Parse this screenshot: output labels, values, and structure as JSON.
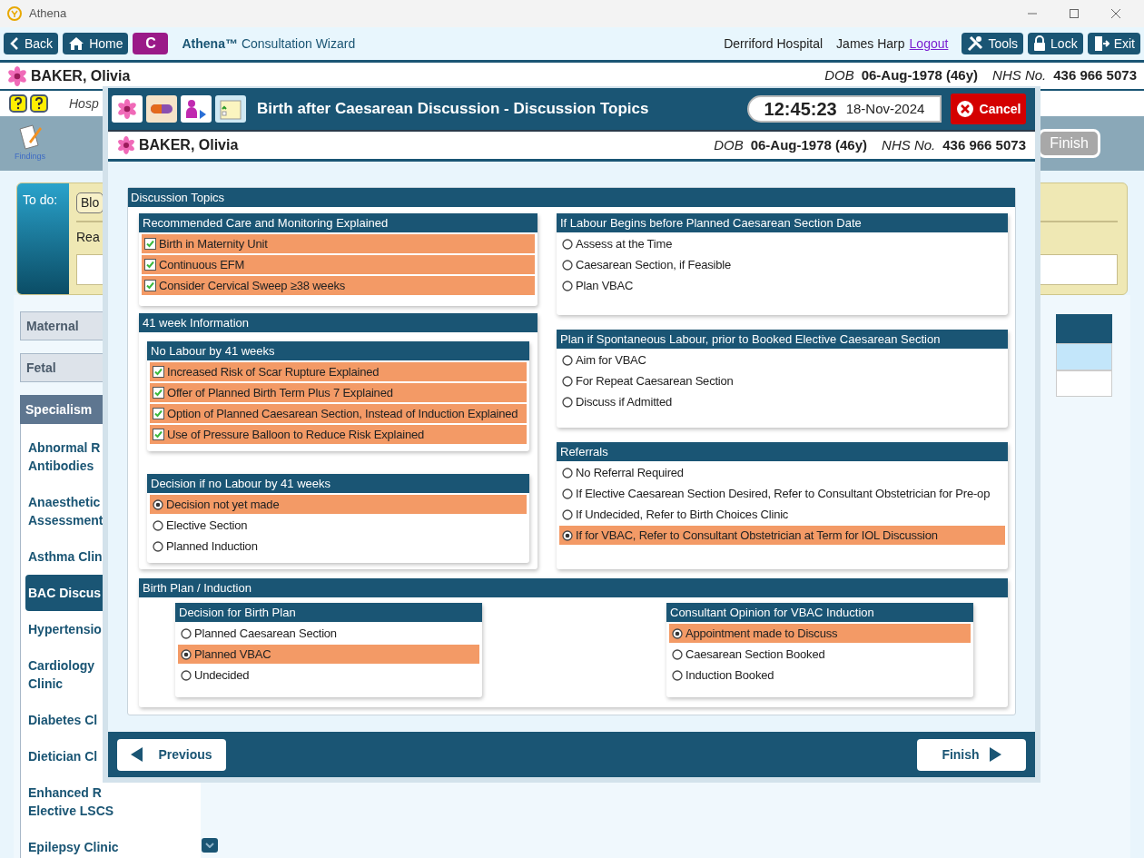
{
  "app_title": "Athena",
  "toolbar": {
    "left_buttons": [
      {
        "label": "Back"
      },
      {
        "label": "Home"
      }
    ],
    "badge": "C",
    "brand": "Athena™",
    "title": "Consultation Wizard",
    "hospital": "Derriford Hospital",
    "user": "James Harp",
    "logout": "Logout",
    "right_buttons": [
      {
        "label": "Tools"
      },
      {
        "label": "Lock"
      },
      {
        "label": "Exit"
      }
    ]
  },
  "patient": {
    "name": "BAKER, Olivia",
    "dob_label": "DOB",
    "dob": "06-Aug-1978 (46y)",
    "nhs_label": "NHS No.",
    "nhs": "436 966 5073"
  },
  "info_row": {
    "text": "Hosp"
  },
  "findings_label": "Findings",
  "finish_button": {
    "label": "Finish",
    "disabled": true
  },
  "todo": {
    "label": "To do:",
    "button": "Blo",
    "reason_label": "Rea"
  },
  "sidebar": {
    "headers": [
      {
        "label": "Maternal"
      },
      {
        "label": "Fetal"
      }
    ],
    "section": "Specialism",
    "items": [
      {
        "lines": [
          "Abnormal R",
          "Antibodies"
        ],
        "selected": false
      },
      {
        "lines": [
          "Anaesthetic",
          "Assessment"
        ],
        "selected": false
      },
      {
        "lines": [
          "Asthma Clin"
        ],
        "selected": false
      },
      {
        "lines": [
          "BAC Discus"
        ],
        "selected": true
      },
      {
        "lines": [
          "Hypertensio"
        ],
        "selected": false
      },
      {
        "lines": [
          "Cardiology",
          "Clinic"
        ],
        "selected": false
      },
      {
        "lines": [
          "Diabetes Cl"
        ],
        "selected": false
      },
      {
        "lines": [
          "Dietician Cl"
        ],
        "selected": false
      },
      {
        "lines": [
          "Enhanced R",
          "Elective LSCS"
        ],
        "selected": false
      },
      {
        "lines": [
          "Epilepsy Clinic"
        ],
        "selected": false
      }
    ]
  },
  "wizard": {
    "title": "Birth after Caesarean Discussion - Discussion Topics",
    "time": "12:45:23",
    "date": "18-Nov-2024",
    "cancel": "Cancel",
    "patient": {
      "name": "BAKER, Olivia",
      "dob_label": "DOB",
      "dob": "06-Aug-1978 (46y)",
      "nhs_label": "NHS No.",
      "nhs": "436 966 5073"
    },
    "panel_title": "Discussion Topics",
    "left_groups": [
      {
        "title": "Recommended Care and Monitoring Explained",
        "items": [
          {
            "kind": "checkbox",
            "label": "Birth in Maternity Unit",
            "checked": true
          },
          {
            "kind": "checkbox",
            "label": "Continuous EFM",
            "checked": true
          },
          {
            "kind": "checkbox",
            "label": "Consider Cervical Sweep ≥38 weeks",
            "checked": true
          }
        ]
      },
      {
        "title": "41 week Information",
        "subgroups": [
          {
            "title": "No Labour by 41 weeks",
            "items": [
              {
                "kind": "checkbox",
                "label": "Increased Risk of Scar Rupture Explained",
                "checked": true
              },
              {
                "kind": "checkbox",
                "label": "Offer of Planned Birth Term Plus 7 Explained",
                "checked": true
              },
              {
                "kind": "checkbox",
                "label": "Option of Planned Caesarean Section, Instead of Induction Explained",
                "checked": true
              },
              {
                "kind": "checkbox",
                "label": "Use of Pressure Balloon to Reduce Risk Explained",
                "checked": true
              }
            ]
          },
          {
            "title": "Decision if no Labour by 41 weeks",
            "items": [
              {
                "kind": "radio",
                "label": "Decision not yet made",
                "selected": true
              },
              {
                "kind": "radio",
                "label": "Elective Section",
                "selected": false
              },
              {
                "kind": "radio",
                "label": "Planned Induction",
                "selected": false
              }
            ]
          }
        ]
      }
    ],
    "right_groups": [
      {
        "title": "If Labour Begins before Planned Caesarean Section Date",
        "items": [
          {
            "kind": "radio",
            "label": "Assess at the Time",
            "selected": false
          },
          {
            "kind": "radio",
            "label": "Caesarean Section, if Feasible",
            "selected": false
          },
          {
            "kind": "radio",
            "label": "Plan VBAC",
            "selected": false
          }
        ]
      },
      {
        "title": "Plan if Spontaneous Labour, prior to Booked Elective Caesarean Section",
        "items": [
          {
            "kind": "radio",
            "label": "Aim for VBAC",
            "selected": false
          },
          {
            "kind": "radio",
            "label": "For Repeat Caesarean Section",
            "selected": false
          },
          {
            "kind": "radio",
            "label": "Discuss if Admitted",
            "selected": false
          }
        ]
      },
      {
        "title": "Referrals",
        "items": [
          {
            "kind": "radio",
            "label": "No Referral Required",
            "selected": false
          },
          {
            "kind": "radio",
            "label": "If Elective Caesarean Section Desired, Refer to Consultant Obstetrician for Pre-op",
            "selected": false
          },
          {
            "kind": "radio",
            "label": "If Undecided, Refer to Birth Choices Clinic",
            "selected": false
          },
          {
            "kind": "radio",
            "label": "If for VBAC, Refer to Consultant Obstetrician at Term for IOL Discussion",
            "selected": true
          }
        ]
      }
    ],
    "birth_plan": {
      "title": "Birth Plan / Induction",
      "subgroups": [
        {
          "title": "Decision for Birth Plan",
          "items": [
            {
              "kind": "radio",
              "label": "Planned Caesarean Section",
              "selected": false
            },
            {
              "kind": "radio",
              "label": "Planned VBAC",
              "selected": true
            },
            {
              "kind": "radio",
              "label": "Undecided",
              "selected": false
            }
          ]
        },
        {
          "title": "Consultant Opinion for VBAC Induction",
          "items": [
            {
              "kind": "radio",
              "label": "Appointment made to Discuss",
              "selected": true
            },
            {
              "kind": "radio",
              "label": "Caesarean Section Booked",
              "selected": false
            },
            {
              "kind": "radio",
              "label": "Induction Booked",
              "selected": false
            }
          ]
        }
      ]
    },
    "previous": "Previous",
    "finish": "Finish"
  }
}
